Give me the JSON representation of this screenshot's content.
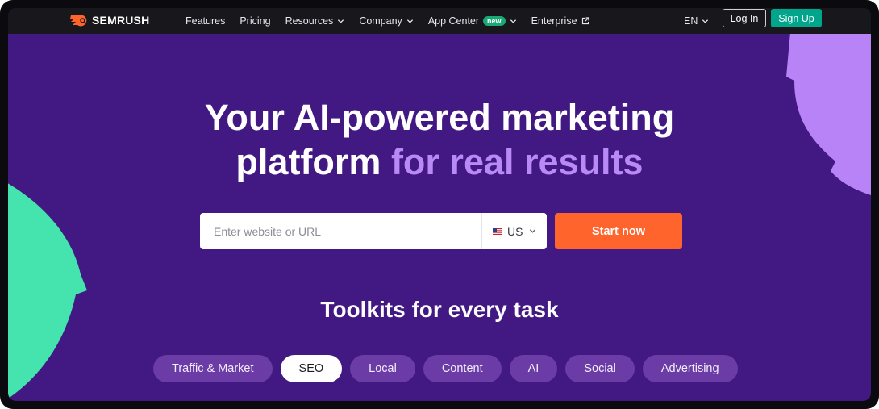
{
  "brand": {
    "name": "SEMRUSH",
    "logo_icon": "semrush-fire-icon",
    "logo_color": "#ff642d"
  },
  "nav": {
    "items": [
      {
        "label": "Features",
        "dropdown": false
      },
      {
        "label": "Pricing",
        "dropdown": false
      },
      {
        "label": "Resources",
        "dropdown": true
      },
      {
        "label": "Company",
        "dropdown": true
      },
      {
        "label": "App Center",
        "dropdown": true,
        "badge": "new"
      },
      {
        "label": "Enterprise",
        "dropdown": false,
        "external": true
      }
    ],
    "language": "EN",
    "login_label": "Log In",
    "signup_label": "Sign Up"
  },
  "hero": {
    "title_line1": "Your AI-powered marketing",
    "title_line2_plain": "platform",
    "title_line2_accent": "for real results",
    "search_placeholder": "Enter website or URL",
    "country": "US",
    "start_label": "Start now"
  },
  "toolkits": {
    "title": "Toolkits for every task",
    "chips": [
      "Traffic & Market",
      "SEO",
      "Local",
      "Content",
      "AI",
      "Social",
      "Advertising"
    ],
    "active": "SEO"
  },
  "colors": {
    "background": "#421983",
    "accent_purple": "#b98af5",
    "cta_orange": "#ff642d",
    "signup_green": "#00a58c",
    "shape_green": "#45e3ae",
    "shape_purple": "#b783f7"
  }
}
